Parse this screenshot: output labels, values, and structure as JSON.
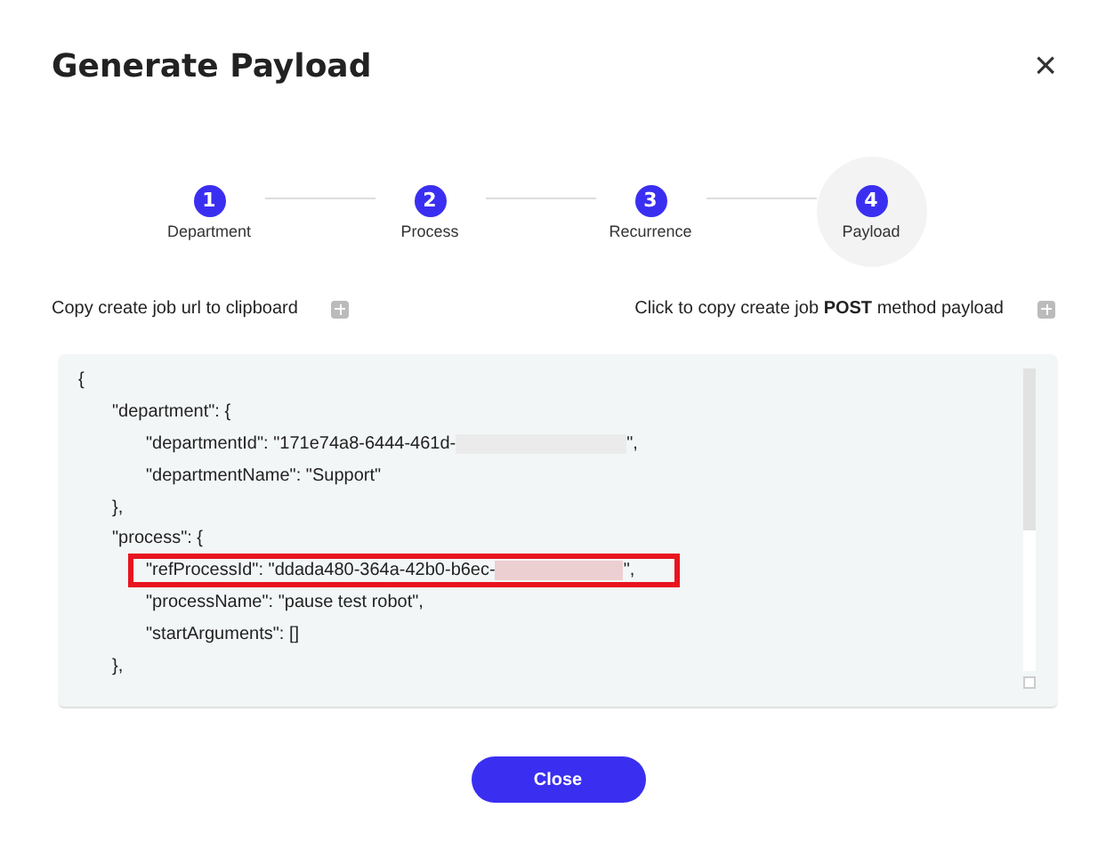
{
  "dialog": {
    "title": "Generate Payload",
    "close": "×"
  },
  "steps": [
    {
      "number": "1",
      "label": "Department",
      "selected": false
    },
    {
      "number": "2",
      "label": "Process",
      "selected": false
    },
    {
      "number": "3",
      "label": "Recurrence",
      "selected": false
    },
    {
      "number": "4",
      "label": "Payload",
      "selected": true
    }
  ],
  "copy_links": [
    {
      "text": "Copy create job url to clipboard"
    },
    {
      "text": "Click to copy create job **POST** method payload"
    }
  ],
  "payload_lines": [
    {
      "text": "{",
      "children": [
        {
          "text": "\"department\": {",
          "children": [
            {
              "text": "\"departmentId\": \"171e74a8-6444-461d-",
              "redacted": true,
              "tail": "\","
            },
            {
              "text": "\"departmentName\": \"Support\""
            }
          ]
        },
        {
          "text": "},"
        },
        {
          "text": "\"process\": {",
          "children": [
            {
              "text": "\"refProcessId\": \"ddada480-364a-42b0-b6ec-",
              "redacted": true,
              "tail": "\",",
              "highlighted": true
            },
            {
              "text": "\"processName\": \"pause test robot\","
            },
            {
              "text": "\"startArguments\": []"
            }
          ]
        },
        {
          "text": "},"
        }
      ]
    }
  ],
  "buttons": [
    {
      "label": "Close"
    }
  ]
}
